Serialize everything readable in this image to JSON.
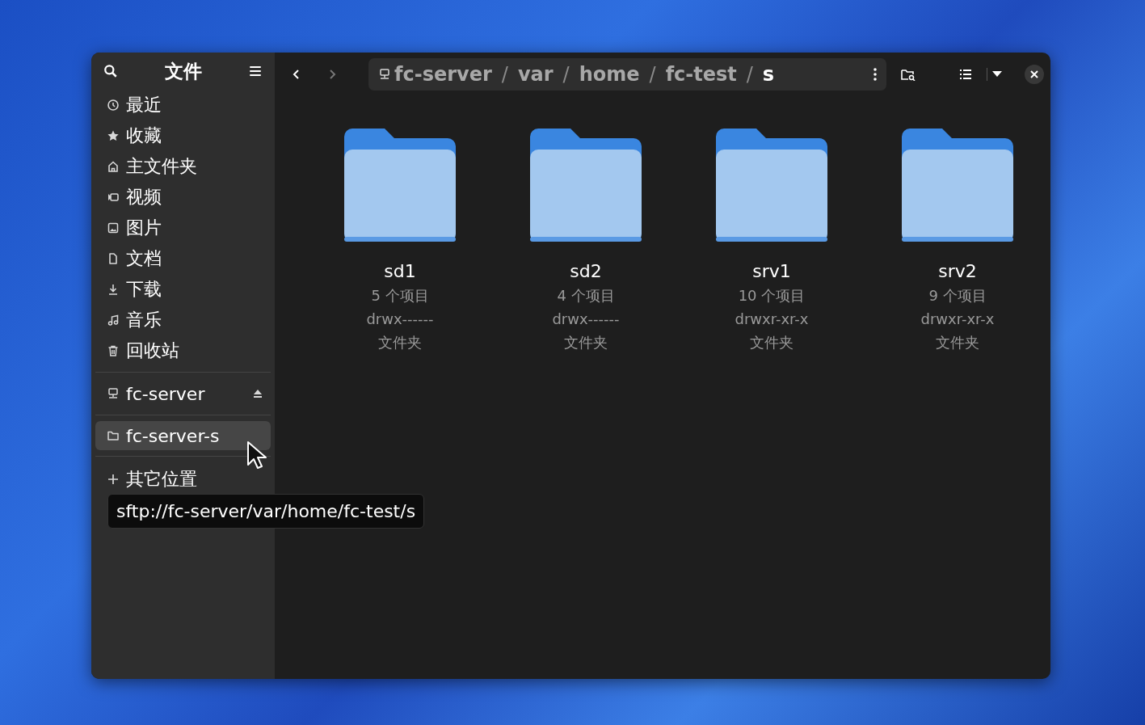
{
  "sidebar": {
    "title": "文件",
    "places": [
      {
        "label": "最近",
        "selected": false
      },
      {
        "label": "收藏",
        "selected": false
      },
      {
        "label": "主文件夹",
        "selected": false
      },
      {
        "label": "视频",
        "selected": false
      },
      {
        "label": "图片",
        "selected": false
      },
      {
        "label": "文档",
        "selected": false
      },
      {
        "label": "下载",
        "selected": false
      },
      {
        "label": "音乐",
        "selected": false
      },
      {
        "label": "回收站",
        "selected": false
      }
    ],
    "mounts": [
      {
        "label": "fc-server",
        "selected": false,
        "ejectable": true
      },
      {
        "label": "fc-server-s",
        "selected": true,
        "ejectable": false
      }
    ],
    "other": {
      "label": "其它位置"
    },
    "tooltip": "sftp://fc-server/var/home/fc-test/s"
  },
  "path_bar": {
    "segments": [
      {
        "label": "fc-server",
        "selected": false
      },
      {
        "label": "var",
        "selected": false
      },
      {
        "label": "home",
        "selected": false
      },
      {
        "label": "fc-test",
        "selected": false
      },
      {
        "label": "s",
        "selected": true
      }
    ],
    "separator": "/"
  },
  "folders": [
    {
      "name": "sd1",
      "count": "5 个项目",
      "permissions": "drwx------",
      "type": "文件夹"
    },
    {
      "name": "sd2",
      "count": "4 个项目",
      "permissions": "drwx------",
      "type": "文件夹"
    },
    {
      "name": "srv1",
      "count": "10 个项目",
      "permissions": "drwxr-xr-x",
      "type": "文件夹"
    },
    {
      "name": "srv2",
      "count": "9 个项目",
      "permissions": "drwxr-xr-x",
      "type": "文件夹"
    }
  ]
}
